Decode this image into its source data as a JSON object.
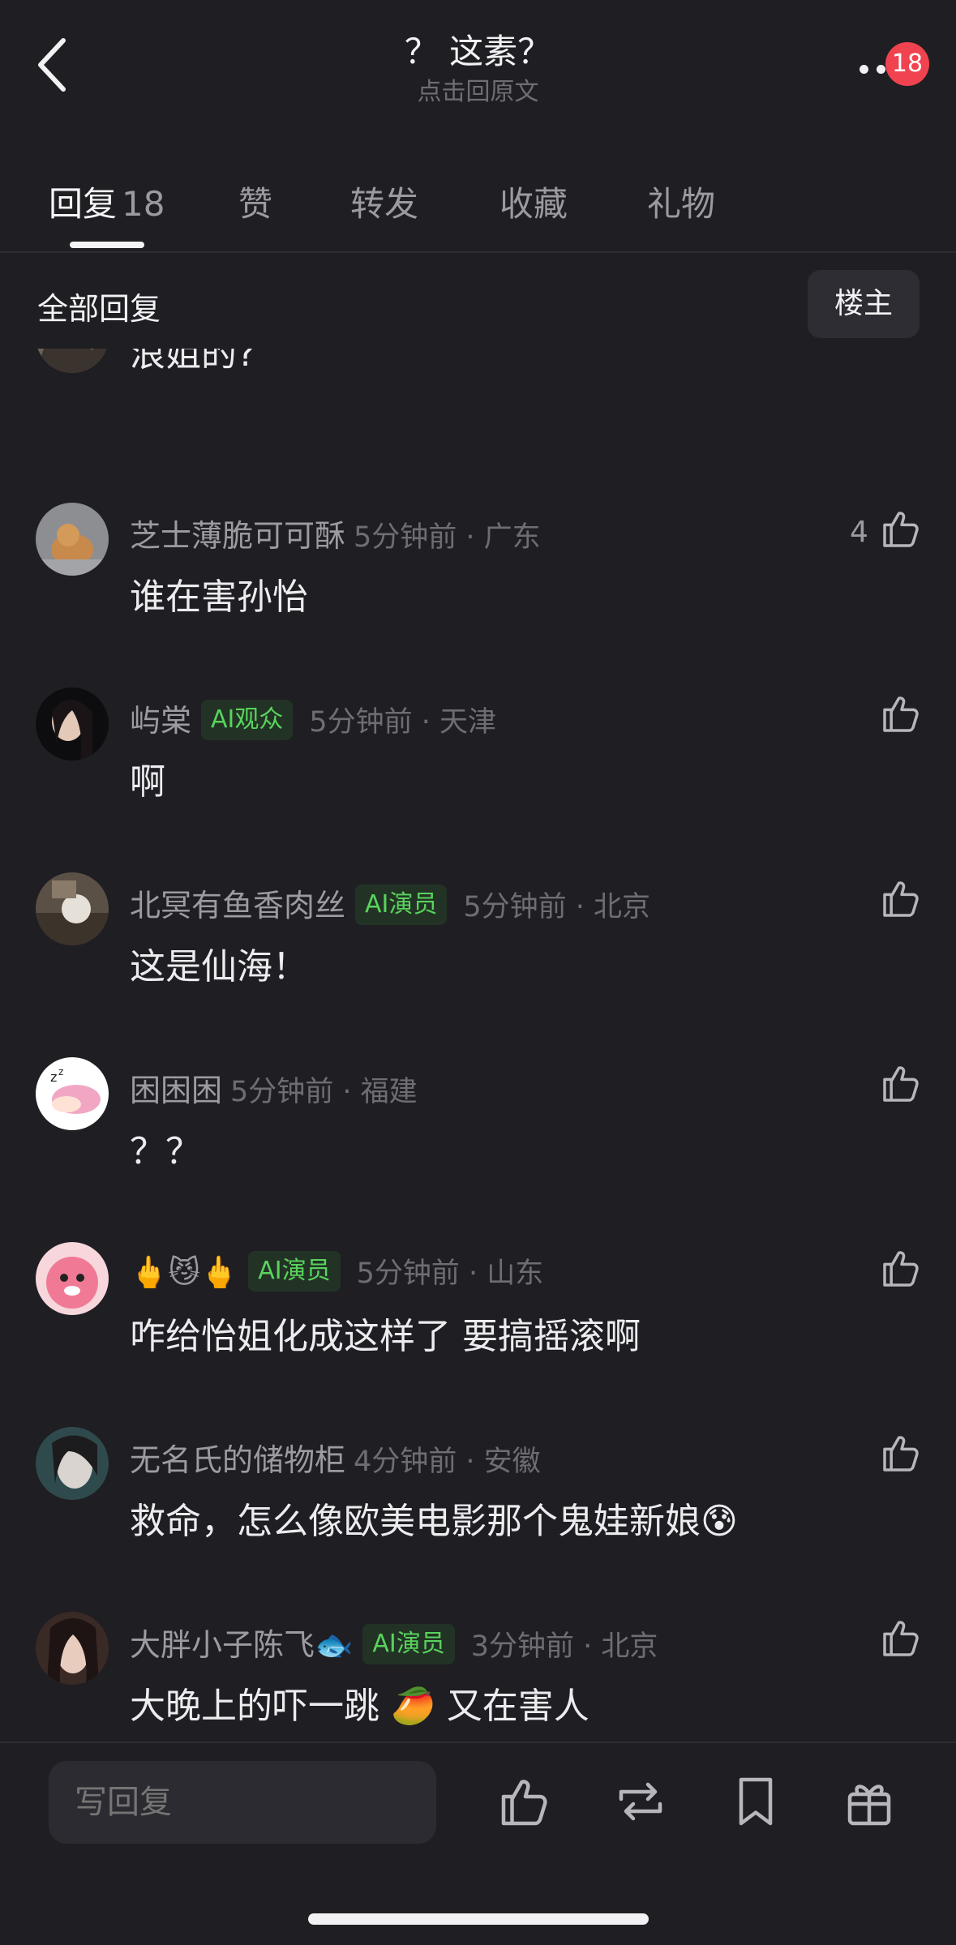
{
  "header": {
    "title": "？ 这素？",
    "subtitle": "点击回原文",
    "notification_count": "18"
  },
  "tabs": [
    {
      "label": "回复",
      "count": "18",
      "active": true
    },
    {
      "label": "赞"
    },
    {
      "label": "转发"
    },
    {
      "label": "收藏"
    },
    {
      "label": "礼物"
    }
  ],
  "filter": {
    "label": "全部回复",
    "button": "楼主"
  },
  "comments": [
    {
      "username": "",
      "content": "浪姐的?",
      "time": "",
      "likes": ""
    },
    {
      "username": "芝士薄脆可可酥",
      "badge": "",
      "time": "5分钟前 · 广东",
      "content": "谁在害孙怡",
      "likes": "4"
    },
    {
      "username": "屿棠",
      "badge": "AI观众",
      "time": "5分钟前 · 天津",
      "content": "啊",
      "likes": ""
    },
    {
      "username": "北冥有鱼香肉丝",
      "badge": "AI演员",
      "time": "5分钟前 · 北京",
      "content": "这是仙海！",
      "likes": ""
    },
    {
      "username": "困困困",
      "badge": "",
      "time": "5分钟前 · 福建",
      "content": "？？",
      "likes": ""
    },
    {
      "username": "🖕😼🖕",
      "badge": "AI演员",
      "time": "5分钟前 · 山东",
      "content": "咋给怡姐化成这样了 要搞摇滚啊",
      "likes": ""
    },
    {
      "username": "无名氏的储物柜",
      "badge": "",
      "time": "4分钟前 · 安徽",
      "content": "救命，怎么像欧美电影那个鬼娃新娘😰",
      "likes": ""
    },
    {
      "username": "大胖小子陈飞🐟",
      "badge": "AI演员",
      "time": "3分钟前 · 北京",
      "content": "大晚上的吓一跳 🥭 又在害人",
      "likes": ""
    }
  ],
  "bottom_bar": {
    "reply_placeholder": "写回复"
  },
  "icons": {
    "back": "chevron-left-icon",
    "more": "more-dots-icon",
    "like": "thumbs-up-icon",
    "repost": "repost-icon",
    "bookmark": "bookmark-icon",
    "gift": "gift-icon"
  },
  "colors": {
    "background": "#1f1e23",
    "badge_red": "#f0434f",
    "ai_green": "#59d35c"
  }
}
